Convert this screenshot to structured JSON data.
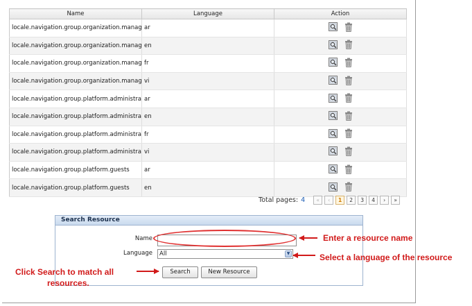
{
  "grid": {
    "columns": [
      "Name",
      "Language",
      "Action"
    ],
    "rows": [
      {
        "name": "locale.navigation.group.organization.managem",
        "lang": "ar"
      },
      {
        "name": "locale.navigation.group.organization.managem",
        "lang": "en"
      },
      {
        "name": "locale.navigation.group.organization.managem",
        "lang": "fr"
      },
      {
        "name": "locale.navigation.group.organization.managem",
        "lang": "vi"
      },
      {
        "name": "locale.navigation.group.platform.administrators",
        "lang": "ar"
      },
      {
        "name": "locale.navigation.group.platform.administrators",
        "lang": "en"
      },
      {
        "name": "locale.navigation.group.platform.administrators",
        "lang": "fr"
      },
      {
        "name": "locale.navigation.group.platform.administrators",
        "lang": "vi"
      },
      {
        "name": "locale.navigation.group.platform.guests",
        "lang": "ar"
      },
      {
        "name": "locale.navigation.group.platform.guests",
        "lang": "en"
      }
    ],
    "action_icons": [
      "edit-icon",
      "trash-icon"
    ]
  },
  "pager": {
    "label": "Total pages:",
    "total": "4",
    "first": "«",
    "prev": "‹",
    "pages": [
      "1",
      "2",
      "3",
      "4"
    ],
    "current": "1",
    "next": "›",
    "last": "»"
  },
  "search": {
    "title": "Search Resource",
    "name_label": "Name",
    "name_value": "",
    "language_label": "Language",
    "language_value": "All",
    "search_button": "Search",
    "new_button": "New Resource"
  },
  "annotations": {
    "enter_name": "Enter a resource name",
    "select_language": "Select a language of the resource",
    "click_search_line1": "Click Search to match all",
    "click_search_line2": "resources."
  },
  "colors": {
    "annotation": "#d11a1a",
    "page_link": "#1f5fb5",
    "current_page": "#d07a00"
  }
}
